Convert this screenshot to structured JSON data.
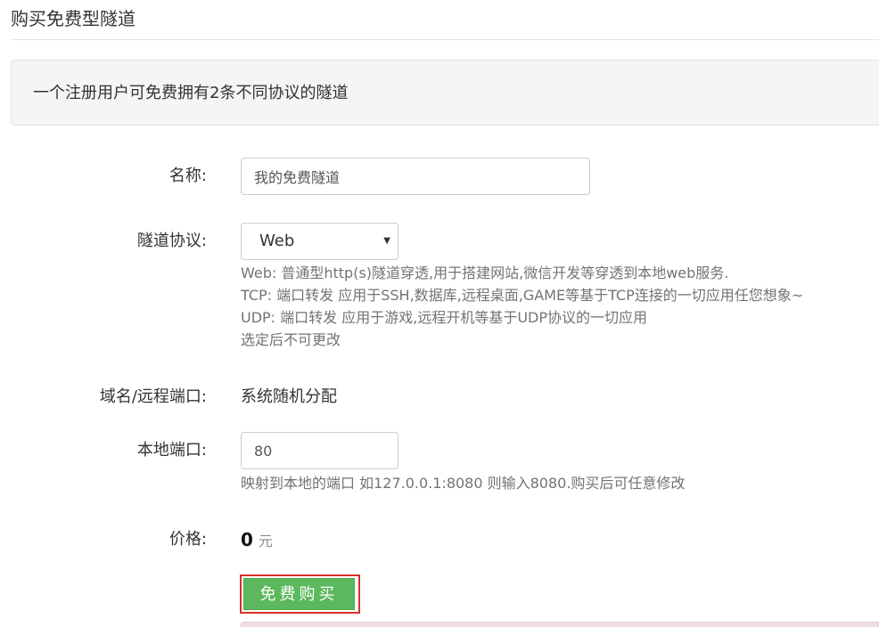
{
  "page": {
    "title": "购买免费型隧道"
  },
  "notice": {
    "text": "一个注册用户可免费拥有2条不同协议的隧道"
  },
  "form": {
    "name": {
      "label": "名称:",
      "value": "我的免费隧道"
    },
    "protocol": {
      "label": "隧道协议:",
      "selected": "Web",
      "caret_icon": "caret-down-icon",
      "help": [
        "Web: 普通型http(s)隧道穿透,用于搭建网站,微信开发等穿透到本地web服务.",
        "TCP: 端口转发 应用于SSH,数据库,远程桌面,GAME等基于TCP连接的一切应用任您想象~",
        "UDP: 端口转发 应用于游戏,远程开机等基于UDP协议的一切应用",
        "选定后不可更改"
      ]
    },
    "domain": {
      "label": "域名/远程端口:",
      "value": "系统随机分配"
    },
    "local_port": {
      "label": "本地端口:",
      "value": "80",
      "help": "映射到本地的端口 如127.0.0.1:8080 则输入8080.购买后可任意修改"
    },
    "price": {
      "label": "价格:",
      "amount": "0",
      "unit": "元"
    },
    "submit": {
      "label": "免费购买"
    }
  },
  "colors": {
    "button_green": "#5cb85c",
    "highlight_red": "#d9302b",
    "help_gray": "#737373",
    "alert_pink": "#f2dede"
  }
}
